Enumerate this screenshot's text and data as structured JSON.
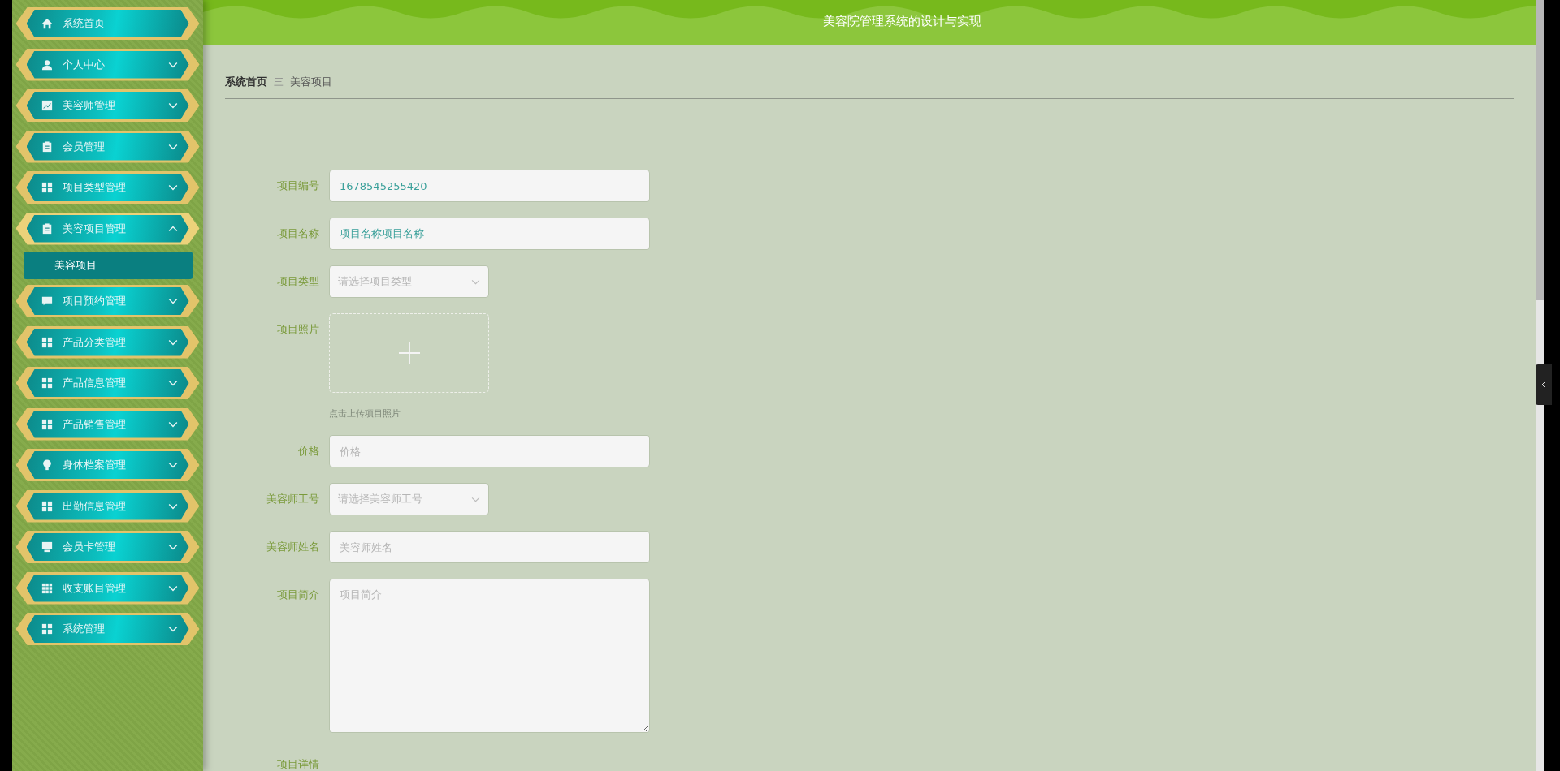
{
  "header": {
    "title": "美容院管理系统的设计与实现"
  },
  "sidebar": {
    "items": [
      {
        "label": "系统首页",
        "kind": "link"
      },
      {
        "label": "个人中心",
        "kind": "submenu",
        "expanded": false
      },
      {
        "label": "美容师管理",
        "kind": "submenu",
        "expanded": false
      },
      {
        "label": "会员管理",
        "kind": "submenu",
        "expanded": false
      },
      {
        "label": "项目类型管理",
        "kind": "submenu",
        "expanded": false
      },
      {
        "label": "美容项目管理",
        "kind": "submenu",
        "expanded": true,
        "children": [
          {
            "label": "美容项目",
            "selected": true
          }
        ]
      },
      {
        "label": "项目预约管理",
        "kind": "submenu",
        "expanded": false
      },
      {
        "label": "产品分类管理",
        "kind": "submenu",
        "expanded": false
      },
      {
        "label": "产品信息管理",
        "kind": "submenu",
        "expanded": false
      },
      {
        "label": "产品销售管理",
        "kind": "submenu",
        "expanded": false
      },
      {
        "label": "身体档案管理",
        "kind": "submenu",
        "expanded": false
      },
      {
        "label": "出勤信息管理",
        "kind": "submenu",
        "expanded": false
      },
      {
        "label": "会员卡管理",
        "kind": "submenu",
        "expanded": false
      },
      {
        "label": "收支账目管理",
        "kind": "submenu",
        "expanded": false
      },
      {
        "label": "系统管理",
        "kind": "submenu",
        "expanded": false
      }
    ]
  },
  "breadcrumb": {
    "items": [
      "系统首页",
      "美容项目"
    ],
    "separator": "三"
  },
  "form": {
    "fields": [
      {
        "label": "项目编号",
        "kind": "text",
        "value": "1678545255420"
      },
      {
        "label": "项目名称",
        "kind": "text",
        "value": "项目名称项目名称"
      },
      {
        "label": "项目类型",
        "kind": "select",
        "placeholder": "请选择项目类型"
      },
      {
        "label": "项目照片",
        "kind": "upload",
        "hint": "点击上传项目照片"
      },
      {
        "label": "价格",
        "kind": "text",
        "placeholder": "价格"
      },
      {
        "label": "美容师工号",
        "kind": "select",
        "placeholder": "请选择美容师工号"
      },
      {
        "label": "美容师姓名",
        "kind": "text",
        "placeholder": "美容师姓名"
      },
      {
        "label": "项目简介",
        "kind": "textarea",
        "placeholder": "项目简介"
      },
      {
        "label": "项目详情",
        "kind": "label"
      }
    ]
  }
}
